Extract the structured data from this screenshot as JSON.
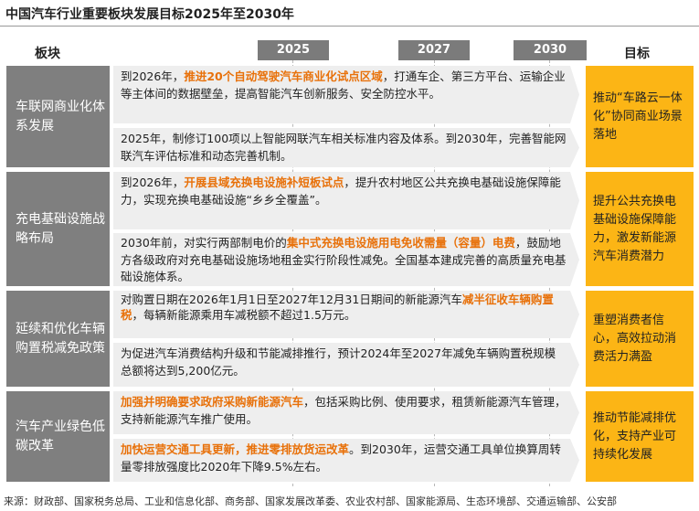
{
  "title": "中国汽车行业重要板块发展目标2025年至2030年",
  "headers": {
    "sector": "板块",
    "goal": "目标"
  },
  "years": [
    "2025",
    "2027",
    "2030"
  ],
  "rows": [
    {
      "category": "车联网商业化体系发展",
      "items": [
        {
          "pre": "到2026年，",
          "highlight": "推进20个自动驾驶汽车商业化试点区域",
          "post": "，打通车企、第三方平台、运输企业等主体间的数据壁垒，提高智能汽车创新服务、安全防控水平。"
        },
        {
          "pre": "2025年，制修订100项以上智能网联汽车相关标准内容及体系。到2030年，完善智能网联汽车评估标准和动态完善机制。",
          "highlight": "",
          "post": ""
        }
      ],
      "goal": "推动“车路云一体化”协同商业场景落地"
    },
    {
      "category": "充电基础设施战略布局",
      "items": [
        {
          "pre": "到2026年，",
          "highlight": "开展县域充换电设施补短板试点",
          "post": "，提升农村地区公共充换电基础设施保障能力，实现充换电基础设施“乡乡全覆盖”。"
        },
        {
          "pre": "2030年前，对实行两部制电价的",
          "highlight": "集中式充换电设施用电免收需量（容量）电费",
          "post": "，鼓励地方各级政府对充电基础设施场地租金实行阶段性减免。全国基本建成完善的高质量充电基础设施体系。"
        }
      ],
      "goal": "提升公共充换电基础设施保障能力，激发新能源汽车消费潜力"
    },
    {
      "category": "延续和优化车辆购置税减免政策",
      "items": [
        {
          "pre": "对购置日期在2026年1月1日至2027年12月31日期间的新能源汽车",
          "highlight": "减半征收车辆购置税",
          "post": "，每辆新能源乘用车减税额不超过1.5万元。"
        },
        {
          "pre": "为促进汽车消费结构升级和节能减排推行，预计2024年至2027年减免车辆购置税规模总额将达到5,200亿元。",
          "highlight": "",
          "post": ""
        }
      ],
      "goal": "重塑消费者信心，高效拉动消费活力满盈"
    },
    {
      "category": "汽车产业绿色低碳改革",
      "items": [
        {
          "pre": "",
          "highlight": "加强并明确要求政府采购新能源汽车",
          "post": "，包括采购比例、使用要求，租赁新能源汽车管理，支持新能源汽车推广使用。"
        },
        {
          "pre": "",
          "highlight": "加快运营交通工具更新，推进零排放货运改革",
          "post": "。到2030年，运营交通工具单位换算周转量零排放强度比2020年下降9.5%左右。"
        }
      ],
      "goal": "推动节能减排优化，支持产业可持续化发展"
    }
  ],
  "source": "来源：财政部、国家税务总局、工业和信息化部、商务部、国家发展改革委、农业农村部、国家能源局、生态环境部、交通运输部、公安部",
  "colors": {
    "category_bg": "#7f7f7f",
    "goal_bg": "#fcb515",
    "highlight": "#e8710a",
    "box_bg": "#eeeeee",
    "year_bg": "#7b7b7b"
  }
}
